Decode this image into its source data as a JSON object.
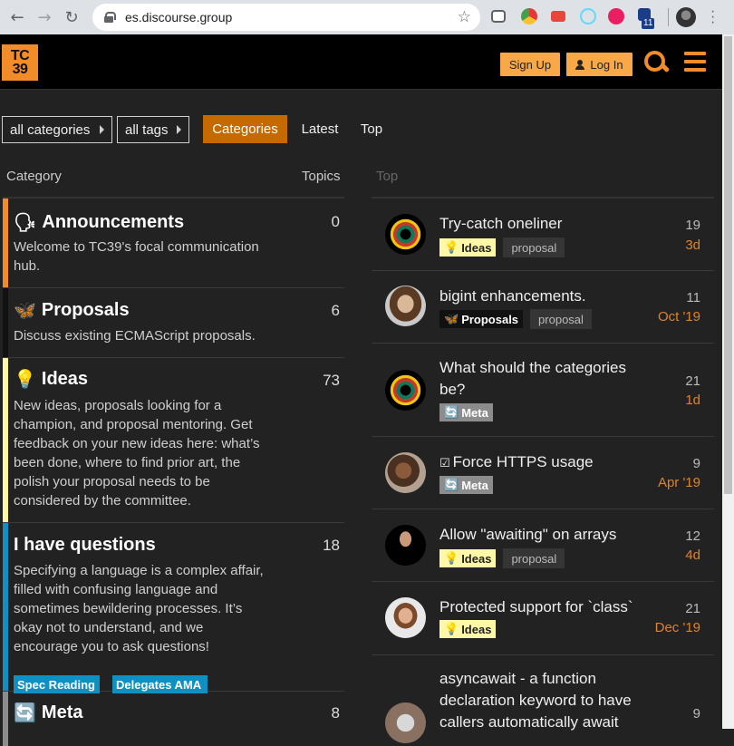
{
  "browser": {
    "url": "es.discourse.group",
    "extension_badge": "11"
  },
  "header": {
    "logo_line1": "TC",
    "logo_line2": "39",
    "signup_label": "Sign Up",
    "login_label": "Log In"
  },
  "nav": {
    "categories_dropdown": "all categories",
    "tags_dropdown": "all tags",
    "tabs": [
      {
        "label": "Categories",
        "active": true
      },
      {
        "label": "Latest",
        "active": false
      },
      {
        "label": "Top",
        "active": false
      }
    ]
  },
  "columns": {
    "category": "Category",
    "topics": "Topics",
    "top": "Top"
  },
  "categories": [
    {
      "emoji": "🗣",
      "name": "Announcements",
      "count": "0",
      "color": "#f28c28",
      "description": "Welcome to TC39's focal communication hub."
    },
    {
      "emoji": "🦋",
      "name": "Proposals",
      "count": "6",
      "color": "#111111",
      "description": "Discuss existing ECMAScript proposals."
    },
    {
      "emoji": "💡",
      "name": "Ideas",
      "count": "73",
      "color": "#fff9a7",
      "description": "New ideas, proposals looking for a champion, and proposal mentoring. Get feedback on your new ideas here: what’s been done, where to find prior art, the polish your proposal needs to be considered by the committee."
    },
    {
      "emoji": "",
      "name": "I have questions",
      "count": "18",
      "color": "#1090c0",
      "description": "Specifying a language is a complex affair, filled with confusing language and sometimes bewildering processes. It’s okay not to understand, and we encourage you to ask questions!",
      "subcategories": [
        "Spec Reading",
        "Delegates AMA"
      ]
    },
    {
      "emoji": "🔄",
      "name": "Meta",
      "count": "8",
      "color": "#8c8c8c",
      "description": ""
    }
  ],
  "topics": [
    {
      "title": "Try-catch oneliner",
      "category": "Ideas",
      "tags": [
        "proposal"
      ],
      "count": "19",
      "age": "3d"
    },
    {
      "title": "bigint enhancements.",
      "category": "Proposals",
      "tags": [
        "proposal"
      ],
      "count": "11",
      "age": "Oct '19"
    },
    {
      "title": "What should the categories be?",
      "category": "Meta",
      "tags": [],
      "count": "21",
      "age": "1d"
    },
    {
      "title": "Force HTTPS usage",
      "category": "Meta",
      "tags": [],
      "count": "9",
      "age": "Apr '19",
      "status_icon": "☑"
    },
    {
      "title": "Allow \"awaiting\" on arrays",
      "category": "Ideas",
      "tags": [
        "proposal"
      ],
      "count": "12",
      "age": "4d"
    },
    {
      "title": "Protected support for `class`",
      "category": "Ideas",
      "tags": [],
      "count": "21",
      "age": "Dec '19"
    },
    {
      "title": "asyncawait - a function declaration keyword to have callers automatically await",
      "category": "",
      "tags": [],
      "count": "9",
      "age": ""
    }
  ],
  "icons": {
    "ideas_badge": "💡",
    "proposals_badge": "🦋",
    "meta_badge": "🔄"
  }
}
